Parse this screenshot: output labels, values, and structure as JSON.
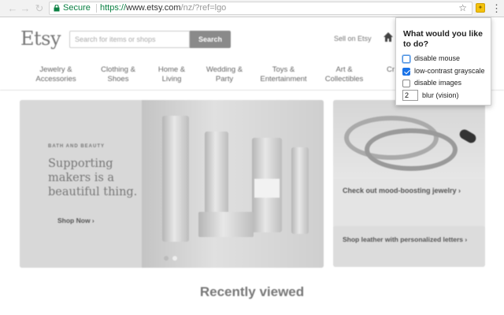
{
  "browser": {
    "secure_label": "Secure",
    "url_scheme": "https://",
    "url_host": "www.etsy.com",
    "url_rest": "/nz/?ref=lgo"
  },
  "header": {
    "logo": "Etsy",
    "search_placeholder": "Search for items or shops",
    "search_button": "Search",
    "sell_link": "Sell on Etsy"
  },
  "categories": [
    "Jewelry &\nAccessories",
    "Clothing &\nShoes",
    "Home &\nLiving",
    "Wedding &\nParty",
    "Toys &\nEntertainment",
    "Art &\nCollectibles",
    "Cr"
  ],
  "hero": {
    "kicker": "BATH AND BEAUTY",
    "title": "Supporting makers is a beautiful thing.",
    "cta": "Shop Now ›"
  },
  "cards": [
    {
      "text": "Check out mood-boosting jewelry ›"
    },
    {
      "text": "Shop leather with personalized letters ›"
    }
  ],
  "section_title": "Recently viewed",
  "popup": {
    "title": "What would you like to do?",
    "options": [
      {
        "label": "disable mouse",
        "checked": false
      },
      {
        "label": "low-contrast grayscale",
        "checked": true
      },
      {
        "label": "disable images",
        "checked": false
      }
    ],
    "blur_value": "2",
    "blur_label": "blur (vision)"
  }
}
